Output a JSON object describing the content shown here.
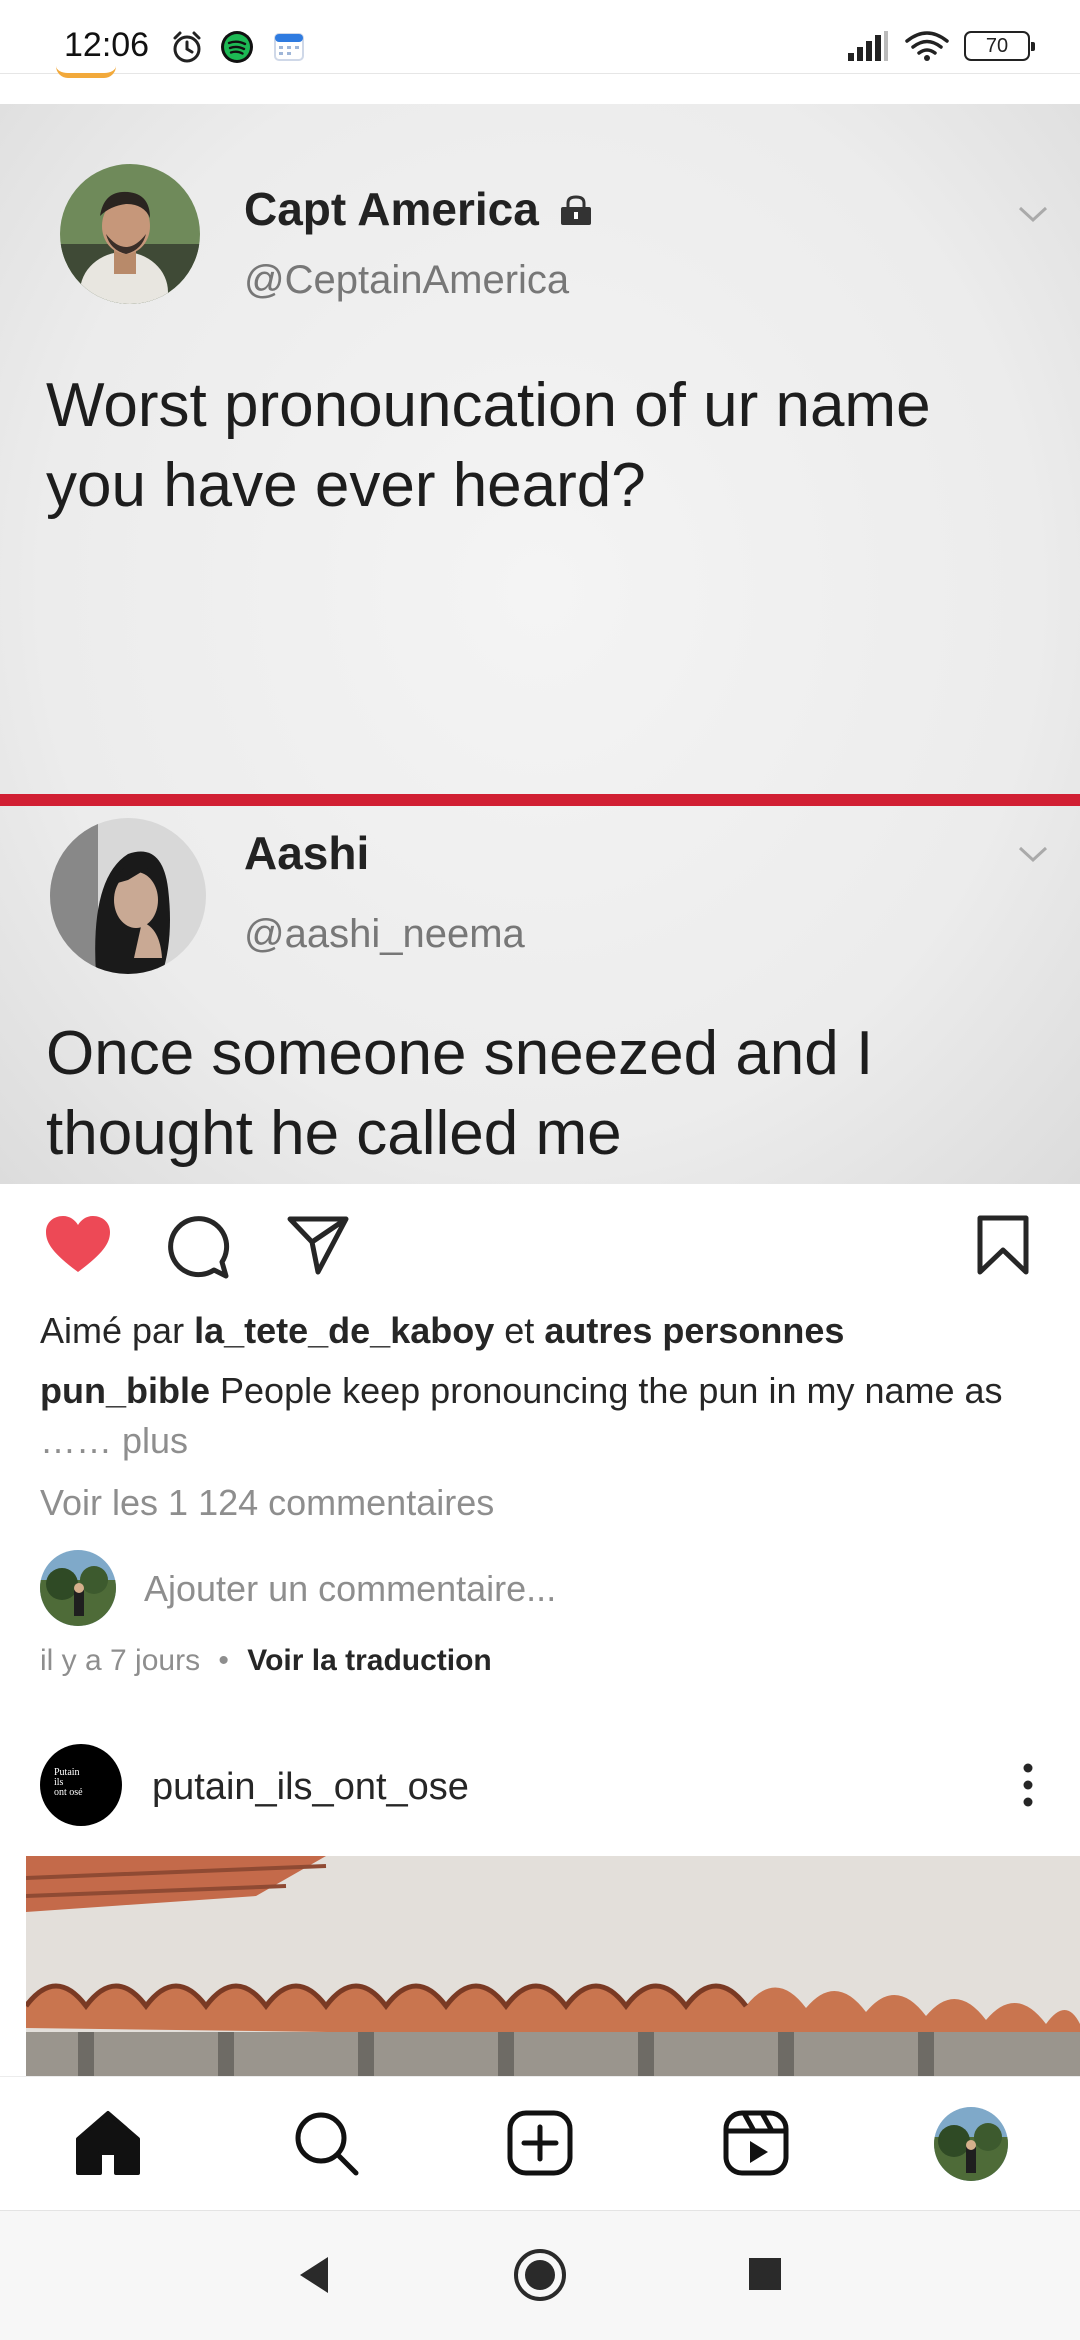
{
  "status_bar": {
    "time": "12:06",
    "battery": "70",
    "icons": [
      "alarm-icon",
      "spotify-icon",
      "calendar-icon",
      "signal-icon",
      "wifi-icon",
      "battery-icon"
    ]
  },
  "post": {
    "image": {
      "tweet1": {
        "name": "Capt America",
        "handle": "@CeptainAmerica",
        "text_line1": "Worst pronouncation of ur name",
        "text_line2": "you have ever heard?"
      },
      "tweet2": {
        "name": "Aashi",
        "handle": "@aashi_neema",
        "text_line1": "Once someone sneezed and I",
        "text_line2": "thought he called me"
      },
      "divider_color": "#d11f33"
    },
    "actions": {
      "like_icon": "heart-filled-icon",
      "like_color": "#ed4956",
      "comment_icon": "comment-icon",
      "share_icon": "paper-plane-icon",
      "save_icon": "bookmark-icon"
    },
    "likes": {
      "prefix": "Aimé par",
      "user": "la_tete_de_kaboy",
      "conj": "et",
      "others": "autres personnes"
    },
    "caption": {
      "username": "pun_bible",
      "text": "People keep pronouncing the pun in my name as",
      "ellipsis": "……",
      "more": "plus"
    },
    "view_comments": "Voir les 1 124 commentaires",
    "add_comment_placeholder": "Ajouter un commentaire...",
    "time_ago": "il y a 7 jours",
    "separator": "•",
    "translate": "Voir la traduction"
  },
  "next_post": {
    "username": "putain_ils_ont_ose",
    "avatar_text_1": "Putain",
    "avatar_text_2": "ils",
    "avatar_text_3": "ont osé"
  },
  "bottom_nav": {
    "items": [
      "home-icon",
      "search-icon",
      "create-icon",
      "reels-icon",
      "profile-avatar"
    ]
  },
  "system_nav": {
    "items": [
      "back-icon",
      "home-circle-icon",
      "recents-icon"
    ]
  }
}
